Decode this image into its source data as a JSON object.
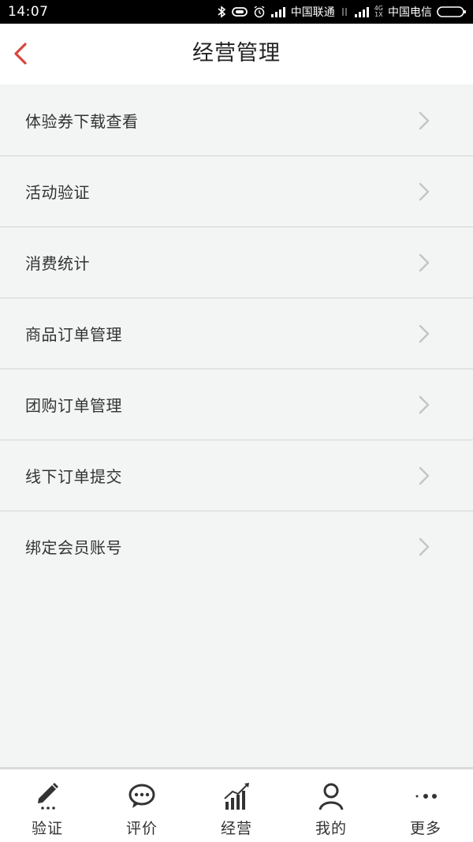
{
  "status_bar": {
    "time": "14:07",
    "carrier1": "中国联通",
    "carrier2": "中国电信",
    "network_badge_top": "4G",
    "network_badge_bottom": "1X",
    "icons": [
      "bluetooth-icon",
      "vibrate-icon",
      "alarm-icon",
      "signal-icon",
      "signal-icon",
      "battery-icon"
    ]
  },
  "header": {
    "title": "经营管理",
    "back_icon": "chevron-left-icon",
    "accent_color": "#d9463c"
  },
  "menu": {
    "items": [
      {
        "label": "体验券下载查看"
      },
      {
        "label": "活动验证"
      },
      {
        "label": "消费统计"
      },
      {
        "label": "商品订单管理"
      },
      {
        "label": "团购订单管理"
      },
      {
        "label": "线下订单提交"
      },
      {
        "label": "绑定会员账号"
      }
    ],
    "chevron_icon": "chevron-right-icon"
  },
  "tabbar": {
    "items": [
      {
        "label": "验证",
        "icon": "pencil-icon"
      },
      {
        "label": "评价",
        "icon": "chat-bubble-icon"
      },
      {
        "label": "经营",
        "icon": "bar-chart-trend-icon"
      },
      {
        "label": "我的",
        "icon": "person-icon"
      },
      {
        "label": "更多",
        "icon": "more-dots-icon"
      }
    ]
  }
}
